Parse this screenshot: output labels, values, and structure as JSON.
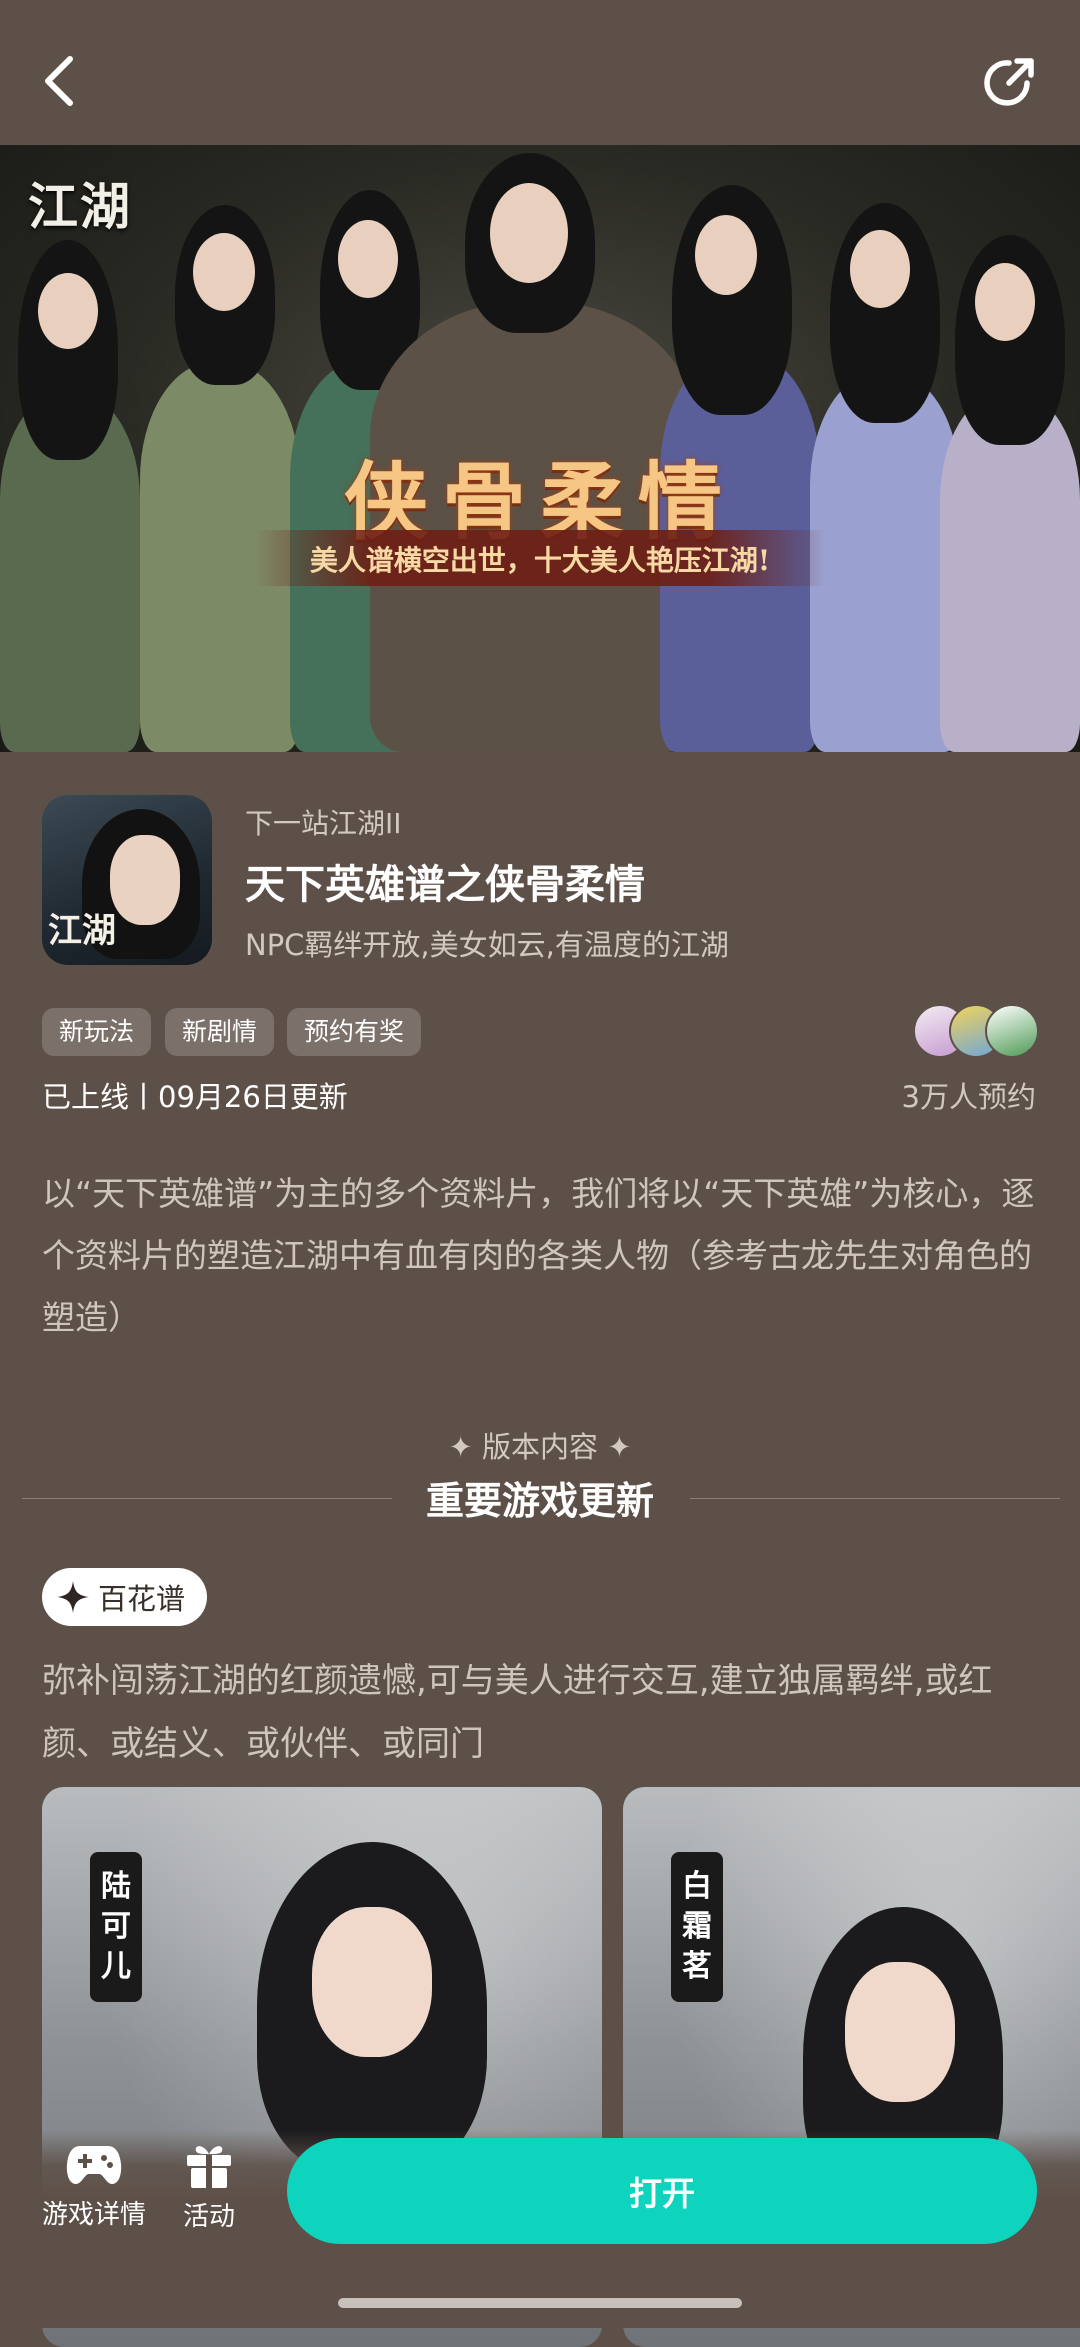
{
  "banner": {
    "logo": "江湖",
    "title": "侠骨柔情",
    "subtitle": "美人谱横空出世，十大美人艳压江湖!"
  },
  "app": {
    "icon_logo": "江湖",
    "subtitle": "下一站江湖II",
    "title": "天下英雄谱之侠骨柔情",
    "description": "NPC羁绊开放,美女如云,有温度的江湖",
    "tags": [
      "新玩法",
      "新剧情",
      "预约有奖"
    ],
    "status": "已上线丨09月26日更新",
    "reservations": "3万人预约"
  },
  "intro": "以“天下英雄谱”为主的多个资料片，我们将以“天下英雄”为核心，逐个资料片的塑造江湖中有血有肉的各类人物（参考古龙先生对角色的塑造）",
  "section": {
    "label": "✦ 版本内容 ✦",
    "title": "重要游戏更新"
  },
  "feature": {
    "pill_label": "百花谱",
    "description": "弥补闯荡江湖的红颜遗憾,可与美人进行交互,建立独属羁绊,或红颜、或结义、或伙伴、或同门"
  },
  "characters": [
    {
      "name_chars": [
        "陆",
        "可",
        "儿"
      ]
    },
    {
      "name_chars": [
        "白",
        "霜",
        "茗"
      ]
    }
  ],
  "bottom_bar": {
    "game_details_label": "游戏详情",
    "activities_label": "活动",
    "open_button": "打开"
  },
  "colors": {
    "background": "#5d5048",
    "accent": "#0ed3bd",
    "tag_bg": "#7b706a"
  }
}
